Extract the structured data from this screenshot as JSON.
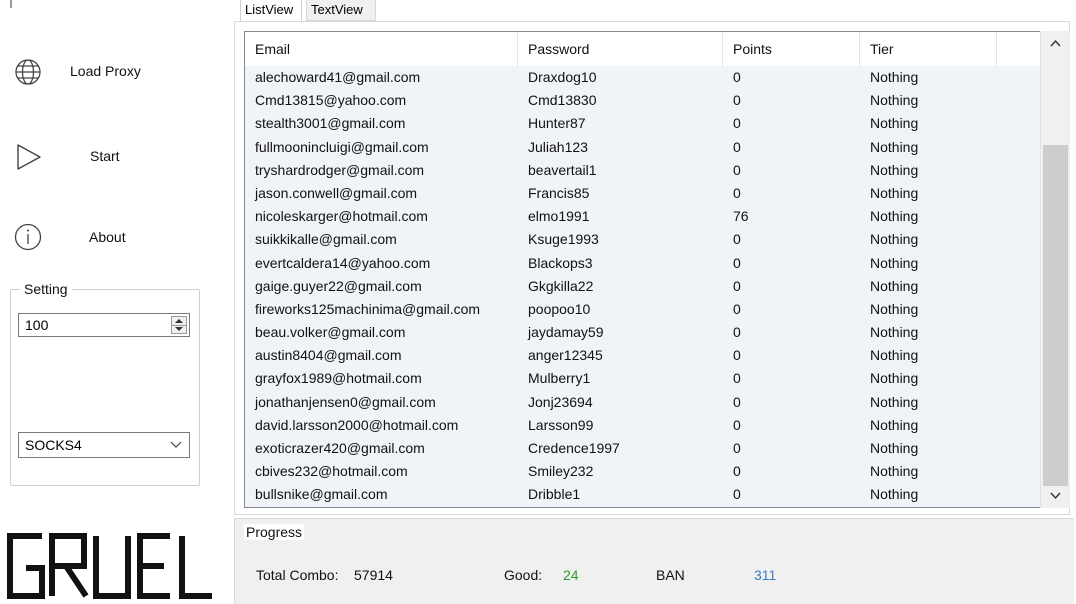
{
  "sidebar": {
    "items": [
      {
        "label": "Load Proxy",
        "icon": "globe-icon"
      },
      {
        "label": "Start",
        "icon": "play-icon"
      },
      {
        "label": "About",
        "icon": "info-icon"
      }
    ],
    "settings": {
      "title": "Setting",
      "threads_value": "100",
      "proxy_type": "SOCKS4"
    },
    "logo_text": "GRUEL"
  },
  "tabs": [
    {
      "label": "ListView",
      "active": true
    },
    {
      "label": "TextView",
      "active": false
    }
  ],
  "table": {
    "columns": [
      "Email",
      "Password",
      "Points",
      "Tier"
    ],
    "rows": [
      [
        "alechoward41@gmail.com",
        "Draxdog10",
        "0",
        "Nothing"
      ],
      [
        "Cmd13815@yahoo.com",
        "Cmd13830",
        "0",
        "Nothing"
      ],
      [
        "stealth3001@gmail.com",
        "Hunter87",
        "0",
        "Nothing"
      ],
      [
        "fullmoonincluigi@gmail.com",
        "Juliah123",
        "0",
        "Nothing"
      ],
      [
        "tryshardrodger@gmail.com",
        "beavertail1",
        "0",
        "Nothing"
      ],
      [
        "jason.conwell@gmail.com",
        "Francis85",
        "0",
        "Nothing"
      ],
      [
        "nicoleskarger@hotmail.com",
        "elmo1991",
        "76",
        "Nothing"
      ],
      [
        "suikkikalle@gmail.com",
        "Ksuge1993",
        "0",
        "Nothing"
      ],
      [
        "evertcaldera14@yahoo.com",
        "Blackops3",
        "0",
        "Nothing"
      ],
      [
        "gaige.guyer22@gmail.com",
        "Gkgkilla22",
        "0",
        "Nothing"
      ],
      [
        "fireworks125machinima@gmail.com",
        "poopoo10",
        "0",
        "Nothing"
      ],
      [
        "beau.volker@gmail.com",
        "jaydamay59",
        "0",
        "Nothing"
      ],
      [
        "austin8404@gmail.com",
        "anger12345",
        "0",
        "Nothing"
      ],
      [
        "grayfox1989@hotmail.com",
        "Mulberry1",
        "0",
        "Nothing"
      ],
      [
        "jonathanjensen0@gmail.com",
        "Jonj23694",
        "0",
        "Nothing"
      ],
      [
        "david.larsson2000@hotmail.com",
        "Larsson99",
        "0",
        "Nothing"
      ],
      [
        "exoticrazer420@gmail.com",
        "Credence1997",
        "0",
        "Nothing"
      ],
      [
        "cbives232@hotmail.com",
        "Smiley232",
        "0",
        "Nothing"
      ],
      [
        "bullsnike@gmail.com",
        "Dribble1",
        "0",
        "Nothing"
      ]
    ]
  },
  "progress": {
    "title": "Progress",
    "total_combo_label": "Total Combo:",
    "total_combo_value": "57914",
    "good_label": "Good:",
    "good_value": "24",
    "ban_label": "BAN",
    "ban_value": "311"
  },
  "colors": {
    "good": "#2e9b2e",
    "ban": "#3a7ebf",
    "list_bg": "#f0f3f7",
    "scroll_thumb": "#cdcdcd"
  }
}
